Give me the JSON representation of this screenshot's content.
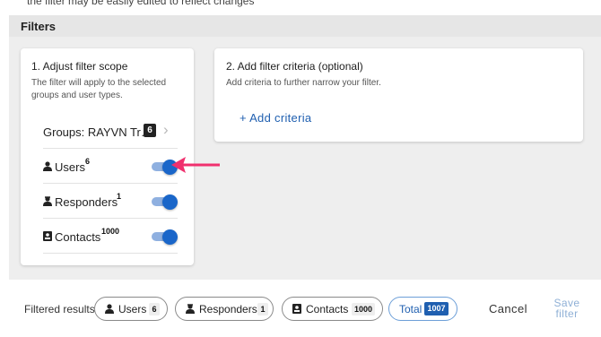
{
  "top_note": "the filter may be easily edited to reflect changes",
  "filters": {
    "title": "Filters"
  },
  "scope": {
    "title": "1. Adjust filter scope",
    "description": "The filter will apply to the selected groups and user types.",
    "groups": {
      "label": "Groups: RAYVN Tr…",
      "count": "6"
    },
    "types": [
      {
        "label": "Users",
        "count": "6",
        "enabled": true
      },
      {
        "label": "Responders",
        "count": "1",
        "enabled": true
      },
      {
        "label": "Contacts",
        "count": "1000",
        "enabled": true
      }
    ]
  },
  "criteria": {
    "title": "2. Add filter criteria (optional)",
    "description": "Add criteria to further narrow your filter.",
    "add_label": "+ Add criteria"
  },
  "results": {
    "label": "Filtered results",
    "pills": [
      {
        "label": "Users",
        "count": "6"
      },
      {
        "label": "Responders",
        "count": "1"
      },
      {
        "label": "Contacts",
        "count": "1000"
      }
    ],
    "total_label": "Total",
    "total_count": "1007"
  },
  "actions": {
    "cancel": "Cancel",
    "save": "Save filter"
  },
  "colors": {
    "accent": "#1f5fb0",
    "toggle_on": "#1a66c9",
    "arrow": "#f0306e",
    "panel_bg": "#eeeeee"
  },
  "icons": {
    "user_type": "person-icon",
    "contact_type": "contact-card-icon",
    "chevron": "chevron-right-icon",
    "pointer": "arrow-icon"
  }
}
